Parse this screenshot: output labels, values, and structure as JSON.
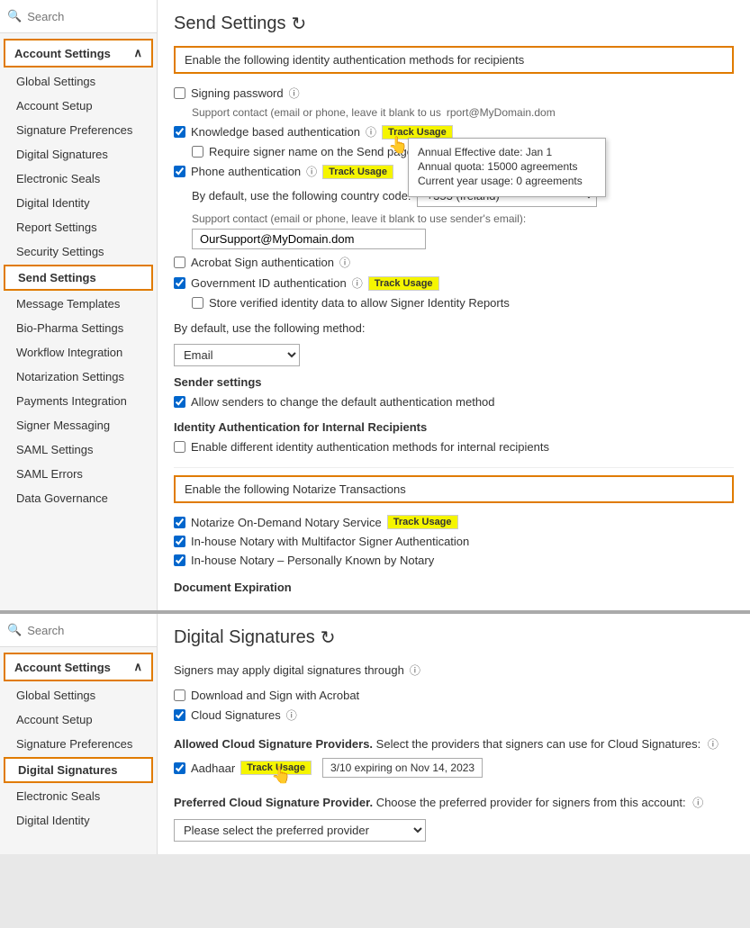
{
  "panels": [
    {
      "id": "send-settings-panel",
      "sidebar": {
        "search_placeholder": "Search",
        "group_label": "Account Settings",
        "items": [
          {
            "label": "Global Settings",
            "active": false
          },
          {
            "label": "Account Setup",
            "active": false
          },
          {
            "label": "Signature Preferences",
            "active": false
          },
          {
            "label": "Digital Signatures",
            "active": false
          },
          {
            "label": "Electronic Seals",
            "active": false
          },
          {
            "label": "Digital Identity",
            "active": false
          },
          {
            "label": "Report Settings",
            "active": false
          },
          {
            "label": "Security Settings",
            "active": false
          },
          {
            "label": "Send Settings",
            "active": true
          },
          {
            "label": "Message Templates",
            "active": false
          },
          {
            "label": "Bio-Pharma Settings",
            "active": false
          },
          {
            "label": "Workflow Integration",
            "active": false
          },
          {
            "label": "Notarization Settings",
            "active": false
          },
          {
            "label": "Payments Integration",
            "active": false
          },
          {
            "label": "Signer Messaging",
            "active": false
          },
          {
            "label": "SAML Settings",
            "active": false
          },
          {
            "label": "SAML Errors",
            "active": false
          },
          {
            "label": "Data Governance",
            "active": false
          }
        ]
      },
      "main": {
        "title": "Send Settings",
        "section1_label": "Enable the following identity authentication methods for recipients",
        "signing_password_label": "Signing password",
        "support_contact_label": "Support contact (email or phone, leave it blank to use",
        "support_contact_suffix": "rport@MyDomain.dom",
        "kba_label": "Knowledge based authentication",
        "kba_checked": true,
        "require_signer_label": "Require signer name on the Send page",
        "require_signer_checked": false,
        "phone_auth_label": "Phone authentication",
        "phone_auth_checked": true,
        "country_code_label": "By default, use the following country code:",
        "country_code_value": "+353 (Ireland)",
        "support_contact2_label": "Support contact (email or phone, leave it blank to use sender's email):",
        "support_contact2_value": "OurSupport@MyDomain.dom",
        "acrobat_sign_label": "Acrobat Sign authentication",
        "acrobat_sign_checked": false,
        "gov_id_label": "Government ID authentication",
        "gov_id_checked": true,
        "store_verified_label": "Store verified identity data to allow Signer Identity Reports",
        "store_verified_checked": false,
        "default_method_label": "By default, use the following method:",
        "default_method_value": "Email",
        "sender_settings_label": "Sender settings",
        "allow_senders_label": "Allow senders to change the default authentication method",
        "allow_senders_checked": true,
        "identity_internal_label": "Identity Authentication for Internal Recipients",
        "enable_internal_label": "Enable different identity authentication methods for internal recipients",
        "enable_internal_checked": false,
        "section2_label": "Enable the following Notarize Transactions",
        "notarize_demand_label": "Notarize On-Demand Notary Service",
        "notarize_demand_checked": true,
        "inhouse_multi_label": "In-house Notary with Multifactor Signer Authentication",
        "inhouse_multi_checked": true,
        "inhouse_personal_label": "In-house Notary – Personally Known by Notary",
        "inhouse_personal_checked": true,
        "doc_expiration_label": "Document Expiration",
        "track_usage_label": "Track Usage",
        "tooltip": {
          "annual_effective": "Annual Effective date: Jan 1",
          "annual_quota": "Annual quota: 15000 agreements",
          "current_usage": "Current year usage: 0 agreements"
        }
      }
    },
    {
      "id": "digital-signatures-panel",
      "sidebar": {
        "search_placeholder": "Search",
        "group_label": "Account Settings",
        "items": [
          {
            "label": "Global Settings",
            "active": false
          },
          {
            "label": "Account Setup",
            "active": false
          },
          {
            "label": "Signature Preferences",
            "active": false
          },
          {
            "label": "Digital Signatures",
            "active": true
          },
          {
            "label": "Electronic Seals",
            "active": false
          },
          {
            "label": "Digital Identity",
            "active": false
          }
        ]
      },
      "main": {
        "title": "Digital Signatures",
        "signers_label": "Signers may apply digital signatures through",
        "download_sign_label": "Download and Sign with Acrobat",
        "download_sign_checked": false,
        "cloud_sig_label": "Cloud Signatures",
        "cloud_sig_checked": true,
        "allowed_cloud_label": "Allowed Cloud Signature Providers.",
        "allowed_cloud_desc": "Select the providers that signers can use for Cloud Signatures:",
        "aadhaar_label": "Aadhaar",
        "aadhaar_checked": true,
        "aadhaar_expiry": "3/10 expiring on Nov 14, 2023",
        "track_usage_label": "Track Usage",
        "preferred_cloud_label": "Preferred Cloud Signature Provider.",
        "preferred_cloud_desc": "Choose the preferred provider for signers from this account:",
        "preferred_placeholder": "Please select the preferred provider"
      }
    }
  ],
  "icons": {
    "search": "🔍",
    "refresh": "↻",
    "chevron_up": "∧",
    "help": "?",
    "cursor": "👆"
  }
}
